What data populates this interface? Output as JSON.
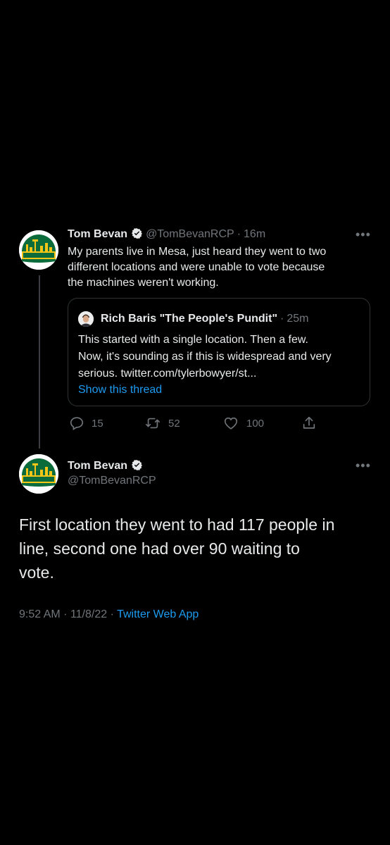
{
  "parent_tweet": {
    "avatar_icon": "sonics-logo-icon",
    "name": "Tom Bevan",
    "handle": "@TomBevanRCP",
    "separator": "·",
    "time": "16m",
    "text_lines": [
      "My parents live in Mesa, just heard they went to two",
      "different locations and were unable to vote because",
      "the machines weren't working."
    ],
    "quote": {
      "name": "Rich Baris \"The People's Pundit\"",
      "separator": "·",
      "time": "25m",
      "text_lines": [
        "This started with a single location. Then a few.",
        "Now, it's sounding as if this is widespread and very",
        "serious. twitter.com/tylerbowyer/st..."
      ],
      "show_thread_label": "Show this thread"
    },
    "actions": {
      "replies": "15",
      "retweets": "52",
      "likes": "100"
    }
  },
  "main_tweet": {
    "avatar_icon": "sonics-logo-icon",
    "name": "Tom Bevan",
    "handle": "@TomBevanRCP",
    "text_lines": [
      "First location they went to had 117 people in",
      "line, second one had over 90 waiting to",
      "vote."
    ],
    "meta": {
      "time": "9:52 AM",
      "sep1": "·",
      "date": "11/8/22",
      "sep2": "·",
      "source": "Twitter Web App"
    }
  },
  "colors": {
    "background": "#000000",
    "text": "#e7e9ea",
    "muted": "#71767b",
    "link": "#1d9bf0",
    "border": "#2f3336",
    "sonics_green": "#0b6b3a",
    "sonics_yellow": "#f5c518"
  }
}
